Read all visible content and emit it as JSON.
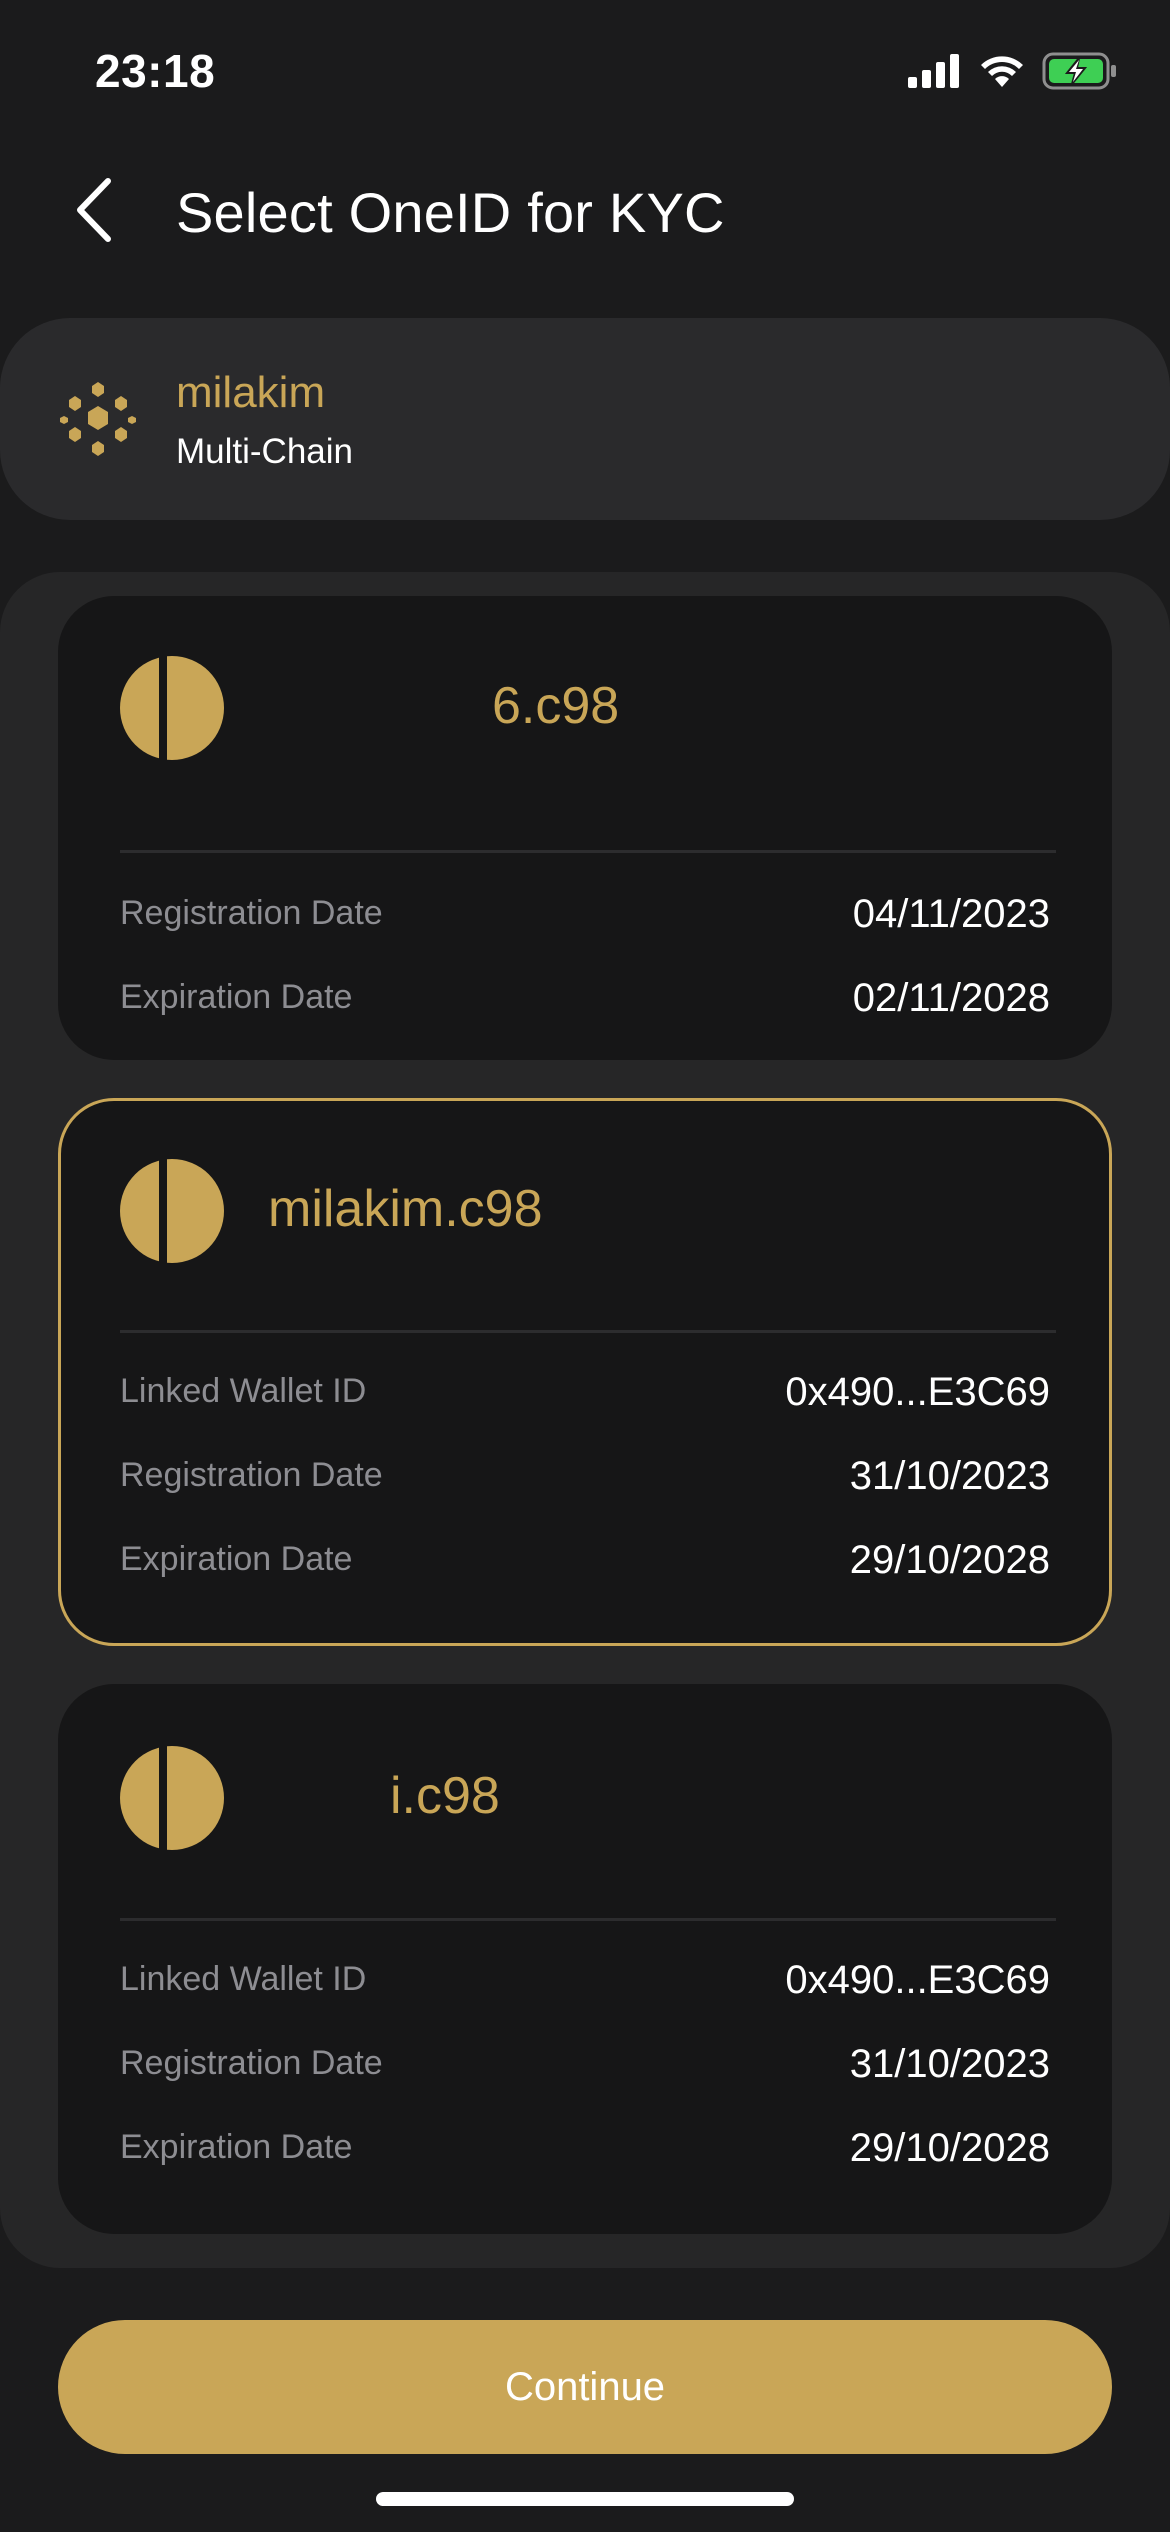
{
  "status_bar": {
    "time": "23:18",
    "icons": [
      "cellular-signal-icon",
      "wifi-icon",
      "battery-charging-icon"
    ]
  },
  "header": {
    "title": "Select OneID for KYC",
    "back_icon": "chevron-left-icon"
  },
  "account": {
    "name": "milakim",
    "network": "Multi-Chain",
    "icon": "hexagon-cluster-icon"
  },
  "oneids": [
    {
      "name_visible": "6.c98",
      "selected": false,
      "rows": [
        {
          "label": "Registration Date",
          "value": "04/11/2023"
        },
        {
          "label": "Expiration Date",
          "value": "02/11/2028"
        }
      ]
    },
    {
      "name_visible": "milakim.c98",
      "selected": true,
      "rows": [
        {
          "label": "Linked Wallet ID",
          "value": "0x490...E3C69"
        },
        {
          "label": "Registration Date",
          "value": "31/10/2023"
        },
        {
          "label": "Expiration Date",
          "value": "29/10/2028"
        }
      ]
    },
    {
      "name_visible": "i.c98",
      "selected": false,
      "rows": [
        {
          "label": "Linked Wallet ID",
          "value": "0x490...E3C69"
        },
        {
          "label": "Registration Date",
          "value": "31/10/2023"
        },
        {
          "label": "Expiration Date",
          "value": "29/10/2028"
        }
      ]
    }
  ],
  "continue_label": "Continue",
  "colors": {
    "accent": "#c9a657",
    "background": "#1b1b1c",
    "card": "#161617",
    "panel": "#262627",
    "muted_text": "#8d8d92"
  }
}
